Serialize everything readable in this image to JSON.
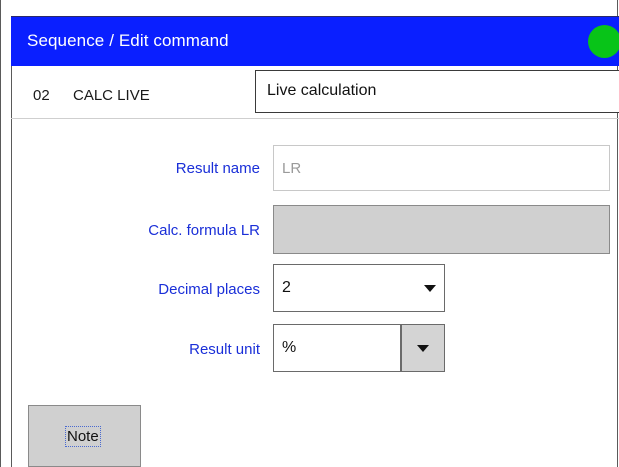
{
  "title": "Sequence / Edit command",
  "colors": {
    "titlebar": "#0a1fff",
    "status_indicator": "#08c418",
    "label_text": "#1a2fd8",
    "field_disabled": "#d0d0d0"
  },
  "status_indicator": {
    "icon": "status-dot-icon",
    "state": "green"
  },
  "command": {
    "number": "02",
    "name": "CALC LIVE",
    "description": "Live calculation"
  },
  "form": {
    "result_name": {
      "label": "Result name",
      "placeholder": "LR",
      "value": ""
    },
    "calc_formula": {
      "label": "Calc. formula LR",
      "value": ""
    },
    "decimal_places": {
      "label": "Decimal places",
      "value": "2",
      "icon": "chevron-down-icon"
    },
    "result_unit": {
      "label": "Result unit",
      "value": "%",
      "icon": "chevron-down-icon"
    }
  },
  "buttons": {
    "note": "Note"
  }
}
